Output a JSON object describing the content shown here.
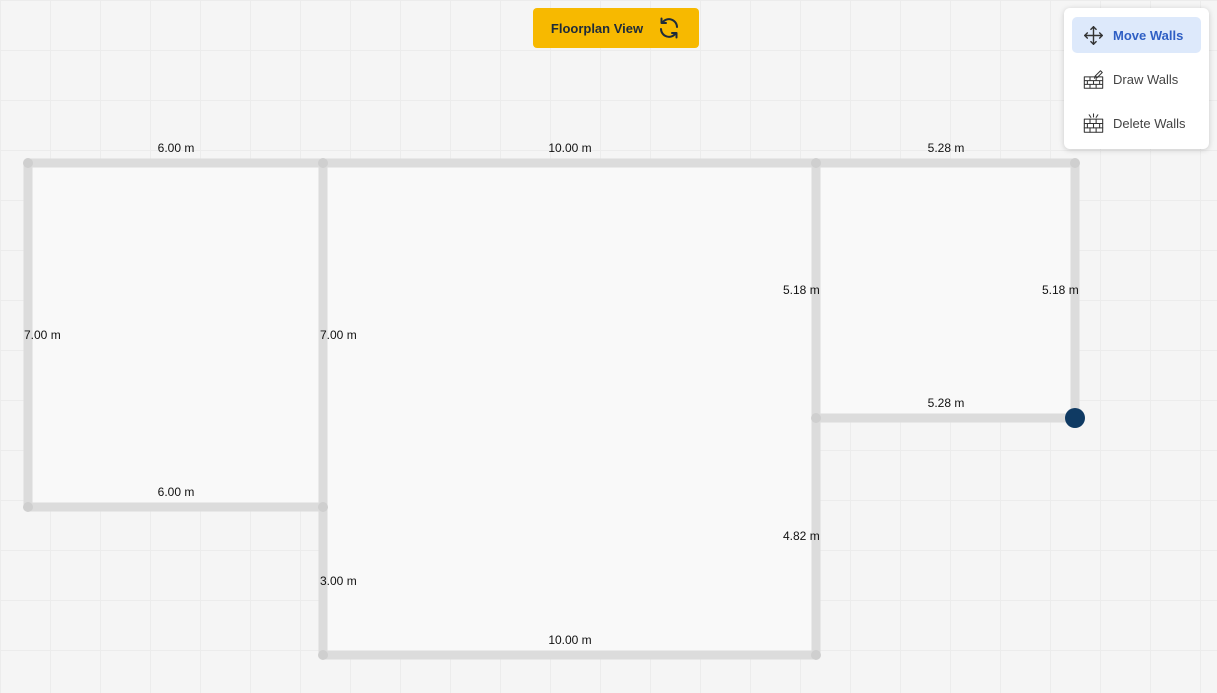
{
  "header": {
    "view_toggle_label": "Floorplan View"
  },
  "toolbox": {
    "items": [
      {
        "label": "Move Walls",
        "icon": "move-arrows-icon",
        "active": true
      },
      {
        "label": "Draw Walls",
        "icon": "brick-wall-pencil-icon",
        "active": false
      },
      {
        "label": "Delete Walls",
        "icon": "brick-wall-explode-icon",
        "active": false
      }
    ]
  },
  "floorplan": {
    "wall_color": "#dcdcdc",
    "selected_node_color": "#0f3a63",
    "dimensions": {
      "top_left": "6.00 m",
      "top_middle": "10.00 m",
      "top_right": "5.28 m",
      "left": "7.00 m",
      "mid_left_vertical": "7.00 m",
      "bottom_left": "6.00 m",
      "lower_vertical": "3.00 m",
      "bottom": "10.00 m",
      "right_inner_vertical": "5.18 m",
      "right_outer_vertical": "5.18 m",
      "inner_horizontal": "5.28 m",
      "lower_right_vertical": "4.82 m"
    }
  },
  "colors": {
    "accent_button": "#f7b900",
    "active_tool_bg": "#dde9fb",
    "active_tool_text": "#2f5fc4"
  }
}
